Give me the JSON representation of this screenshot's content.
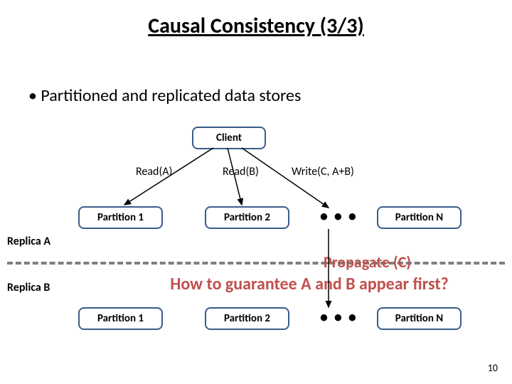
{
  "title": "Causal Consistency (3/3)",
  "bullet": "Partitioned and replicated data stores",
  "client": "Client",
  "ops": {
    "readA": "Read(A)",
    "readB": "Read(B)",
    "writeC": "Write(C, A+B)"
  },
  "partitions": {
    "p1": "Partition 1",
    "p2": "Partition 2",
    "pN": "Partition N",
    "dots": "• • •"
  },
  "replicas": {
    "a": "Replica A",
    "b": "Replica B"
  },
  "annotations": {
    "propagate": "Propagate (C)",
    "question": "How to guarantee A and B appear first?"
  },
  "pagenum": "10"
}
